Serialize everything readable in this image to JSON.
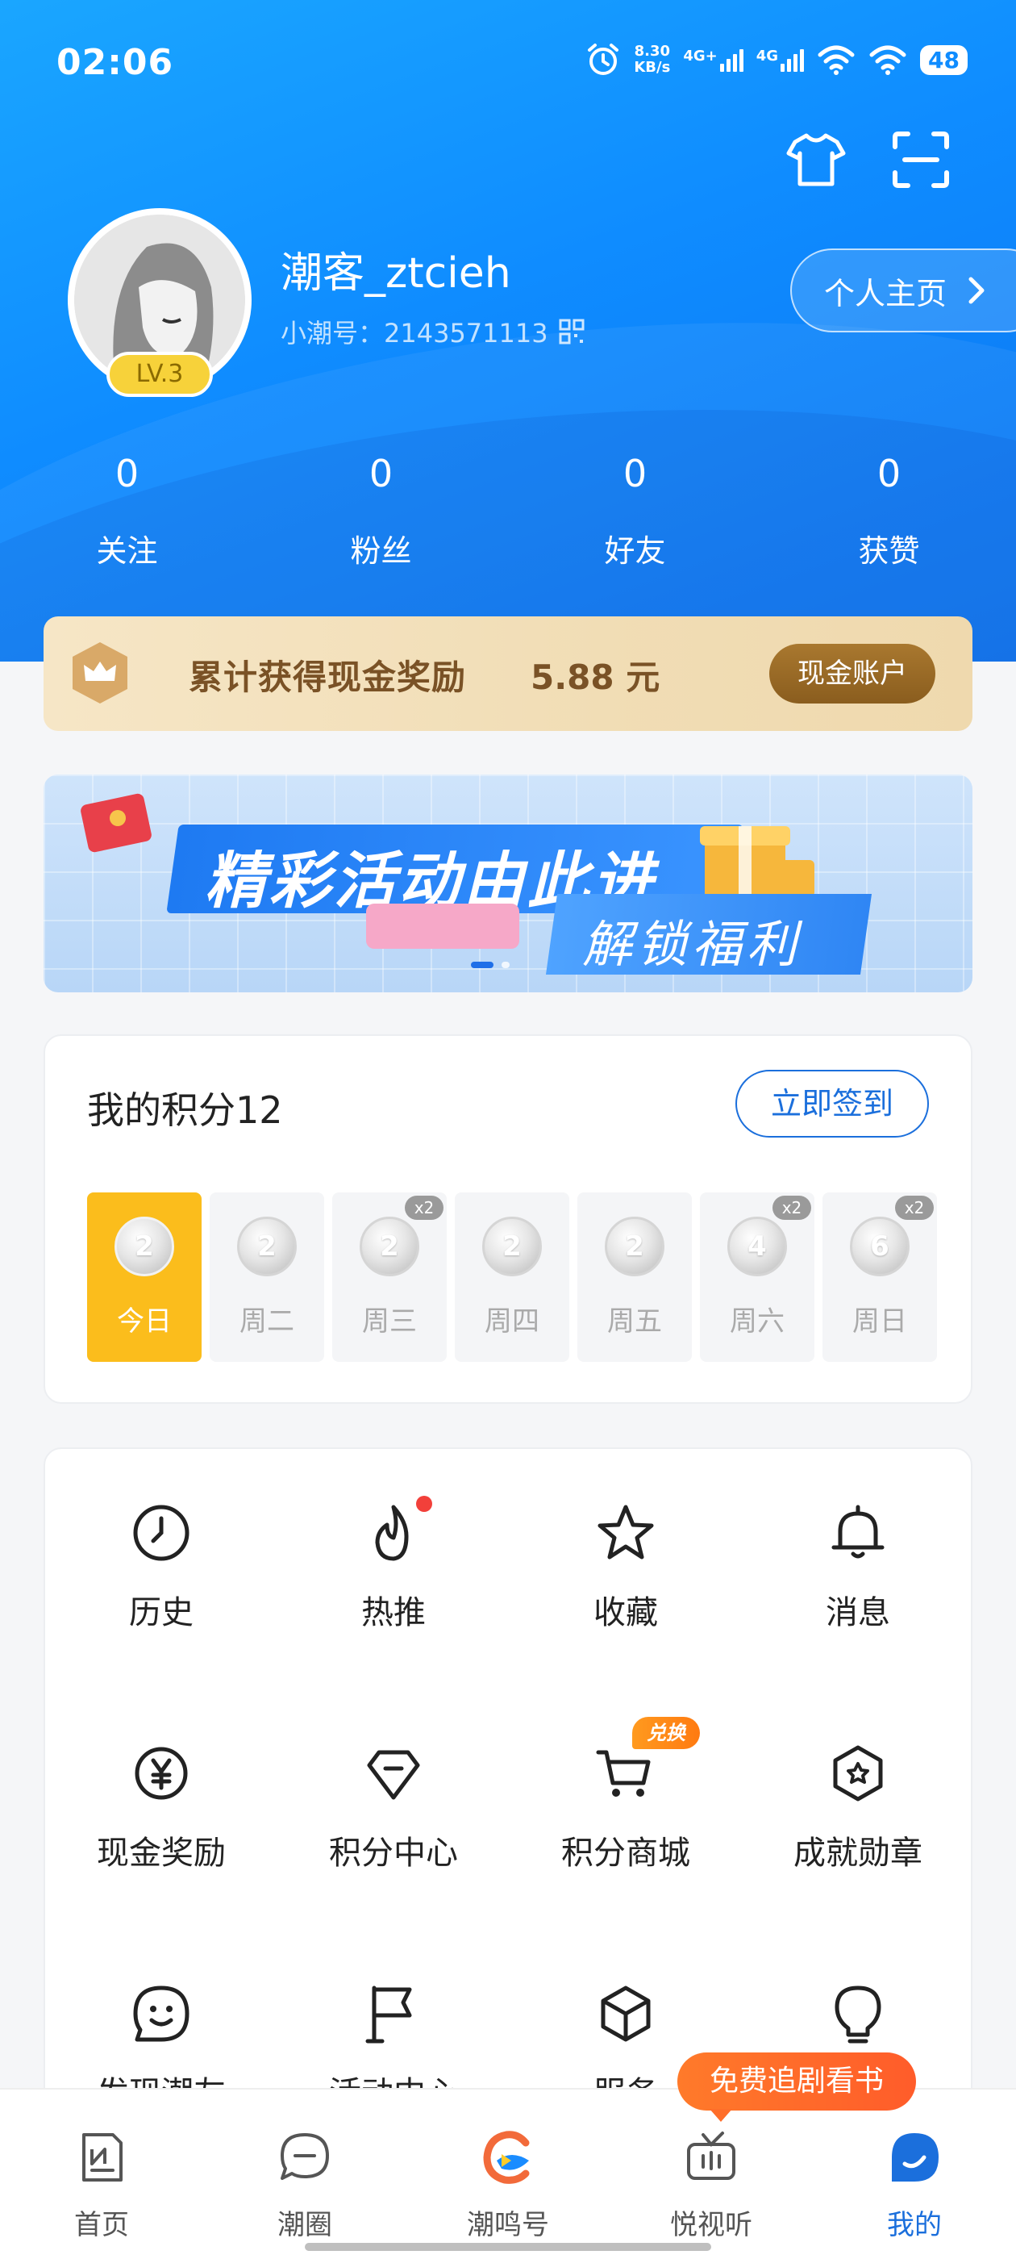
{
  "status_bar": {
    "time": "02:06",
    "speed_value": "8.30",
    "speed_unit": "KB/s",
    "net1": "4G+",
    "net2": "4G",
    "battery": "48"
  },
  "profile": {
    "username": "潮客_ztcieh",
    "id_label": "小潮号：2143571113",
    "level": "LV.3",
    "homepage_button": "个人主页"
  },
  "stats": [
    {
      "value": "0",
      "label": "关注"
    },
    {
      "value": "0",
      "label": "粉丝"
    },
    {
      "value": "0",
      "label": "好友"
    },
    {
      "value": "0",
      "label": "获赞"
    }
  ],
  "cash_bar": {
    "text": "累计获得现金奖励",
    "amount": "5.88 元",
    "button": "现金账户"
  },
  "banner": {
    "title": "精彩活动由此进",
    "subtitle": "解锁福利",
    "active_slide": 1,
    "slide_count": 2
  },
  "points": {
    "title": "我的积分12",
    "signin_button": "立即签到",
    "days": [
      {
        "label": "今日",
        "points": "2",
        "today": true,
        "bonus": ""
      },
      {
        "label": "周二",
        "points": "2",
        "today": false,
        "bonus": ""
      },
      {
        "label": "周三",
        "points": "2",
        "today": false,
        "bonus": "x2"
      },
      {
        "label": "周四",
        "points": "2",
        "today": false,
        "bonus": ""
      },
      {
        "label": "周五",
        "points": "2",
        "today": false,
        "bonus": ""
      },
      {
        "label": "周六",
        "points": "4",
        "today": false,
        "bonus": "x2"
      },
      {
        "label": "周日",
        "points": "6",
        "today": false,
        "bonus": "x2"
      }
    ]
  },
  "menu": {
    "items": [
      {
        "label": "历史",
        "icon": "clock-icon"
      },
      {
        "label": "热推",
        "icon": "flame-icon"
      },
      {
        "label": "收藏",
        "icon": "star-icon"
      },
      {
        "label": "消息",
        "icon": "bell-icon"
      },
      {
        "label": "现金奖励",
        "icon": "yuan-coin-icon"
      },
      {
        "label": "积分中心",
        "icon": "diamond-icon"
      },
      {
        "label": "积分商城",
        "icon": "cart-icon"
      },
      {
        "label": "成就勋章",
        "icon": "badge-icon"
      },
      {
        "label": "发现潮友",
        "icon": "smile-icon"
      },
      {
        "label": "活动中心",
        "icon": "flag-icon"
      },
      {
        "label": "服务",
        "icon": "cube-icon"
      },
      {
        "label": "",
        "icon": "bulb-icon"
      }
    ],
    "exchange_badge": "兑换"
  },
  "promo": "免费追剧看书",
  "tabs": [
    {
      "label": "首页",
      "icon": "news-icon",
      "active": false
    },
    {
      "label": "潮圈",
      "icon": "chat-icon",
      "active": false
    },
    {
      "label": "潮鸣号",
      "icon": "brand-c-icon",
      "active": false
    },
    {
      "label": "悦视听",
      "icon": "tv-icon",
      "active": false
    },
    {
      "label": "我的",
      "icon": "me-icon",
      "active": true
    }
  ],
  "colors": {
    "primary": "#1b6fdc",
    "hero": "#0f8cff",
    "today": "#fbbd1c",
    "cash_text": "#7a5226",
    "promo": "#ff6a2a",
    "reddot": "#f2403a"
  }
}
